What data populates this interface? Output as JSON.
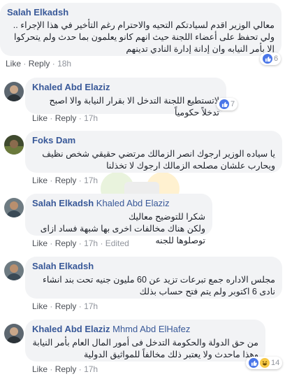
{
  "actions": {
    "like": "Like",
    "reply": "Reply",
    "sep": "·",
    "edited": "Edited"
  },
  "colors": {
    "name": "#385898",
    "bubble": "#f2f3f5",
    "like_blue": "#4a76e8"
  },
  "comments": [
    {
      "name": "Salah Elkadsh",
      "text": "معالي الوزير اقدم لسيادتكم التحيه والاحترام رغم التأخير في هذا الإجراء .. ولي تحفظ على أعضاء اللجنة حيث انهم كانو يعلمون بما حدث ولم يتحركوا إلا بأمر النيابه وان إدانة إدارة النادي تدينهم",
      "time": "18h",
      "reactions": {
        "count": "6",
        "types": [
          "like-icon"
        ]
      }
    },
    {
      "name": "Khaled Abd Elaziz",
      "text": "لاتستطيع اللجنة التدخل الا بقرار النيابة والا اصبح تدخلاً حكومياً",
      "time": "17h",
      "reactions": {
        "count": "7",
        "types": [
          "like-icon"
        ]
      }
    },
    {
      "name": "Foks Dam",
      "text": "يا سياده الوزير ارجوك انصر الزمالك مرتضي حقيقي شخص نظيف ويحارب علشان مصلحه الزمالك ارجوك لا تخذلنا",
      "time": "17h"
    },
    {
      "name": "Salah Elkadsh",
      "tag": "Khaled Abd Elaziz",
      "text": "شكرا للتوضيح معاليك\nولكن هناك مخالفات اخرى بها شبهة فساد ازاى توصلوها للجنه",
      "time": "17h",
      "edited": true
    },
    {
      "name": "Salah Elkadsh",
      "text": "مجلس الاداره جمع تبرعات تزيد عن 60 مليون جنيه تحت بند انشاء نادى 6 اكتوبر ولم يتم فتح حساب بذلك",
      "time": "17h"
    },
    {
      "name": "Khaled Abd Elaziz",
      "tag": "Mhmd Abd ElHafez",
      "text": "من حق الدولة والحكومة التدخل فى أمور المال العام بأمر النيابة وهذا ماحدث ولا يعتبر ذلك مخالفاً للمواثيق الدولية",
      "time": "17h",
      "reactions": {
        "count": "14",
        "types": [
          "like-icon",
          "haha-icon"
        ]
      }
    }
  ]
}
